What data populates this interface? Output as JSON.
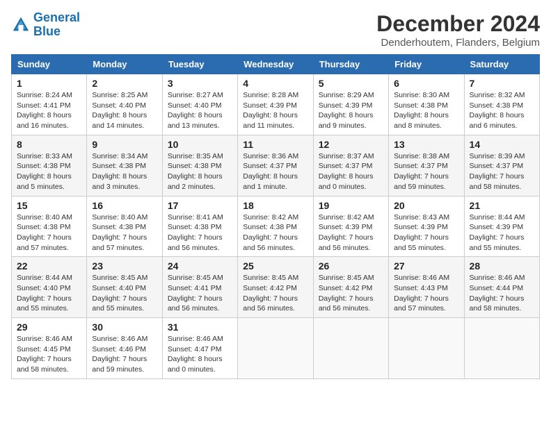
{
  "header": {
    "logo_line1": "General",
    "logo_line2": "Blue",
    "title": "December 2024",
    "subtitle": "Denderhoutem, Flanders, Belgium"
  },
  "calendar": {
    "days_of_week": [
      "Sunday",
      "Monday",
      "Tuesday",
      "Wednesday",
      "Thursday",
      "Friday",
      "Saturday"
    ],
    "weeks": [
      [
        null,
        {
          "day": "2",
          "sunrise": "Sunrise: 8:25 AM",
          "sunset": "Sunset: 4:40 PM",
          "daylight": "Daylight: 8 hours and 14 minutes."
        },
        {
          "day": "3",
          "sunrise": "Sunrise: 8:27 AM",
          "sunset": "Sunset: 4:40 PM",
          "daylight": "Daylight: 8 hours and 13 minutes."
        },
        {
          "day": "4",
          "sunrise": "Sunrise: 8:28 AM",
          "sunset": "Sunset: 4:39 PM",
          "daylight": "Daylight: 8 hours and 11 minutes."
        },
        {
          "day": "5",
          "sunrise": "Sunrise: 8:29 AM",
          "sunset": "Sunset: 4:39 PM",
          "daylight": "Daylight: 8 hours and 9 minutes."
        },
        {
          "day": "6",
          "sunrise": "Sunrise: 8:30 AM",
          "sunset": "Sunset: 4:38 PM",
          "daylight": "Daylight: 8 hours and 8 minutes."
        },
        {
          "day": "7",
          "sunrise": "Sunrise: 8:32 AM",
          "sunset": "Sunset: 4:38 PM",
          "daylight": "Daylight: 8 hours and 6 minutes."
        }
      ],
      [
        {
          "day": "1",
          "sunrise": "Sunrise: 8:24 AM",
          "sunset": "Sunset: 4:41 PM",
          "daylight": "Daylight: 8 hours and 16 minutes."
        },
        {
          "day": "9",
          "sunrise": "Sunrise: 8:34 AM",
          "sunset": "Sunset: 4:38 PM",
          "daylight": "Daylight: 8 hours and 3 minutes."
        },
        {
          "day": "10",
          "sunrise": "Sunrise: 8:35 AM",
          "sunset": "Sunset: 4:38 PM",
          "daylight": "Daylight: 8 hours and 2 minutes."
        },
        {
          "day": "11",
          "sunrise": "Sunrise: 8:36 AM",
          "sunset": "Sunset: 4:37 PM",
          "daylight": "Daylight: 8 hours and 1 minute."
        },
        {
          "day": "12",
          "sunrise": "Sunrise: 8:37 AM",
          "sunset": "Sunset: 4:37 PM",
          "daylight": "Daylight: 8 hours and 0 minutes."
        },
        {
          "day": "13",
          "sunrise": "Sunrise: 8:38 AM",
          "sunset": "Sunset: 4:37 PM",
          "daylight": "Daylight: 7 hours and 59 minutes."
        },
        {
          "day": "14",
          "sunrise": "Sunrise: 8:39 AM",
          "sunset": "Sunset: 4:37 PM",
          "daylight": "Daylight: 7 hours and 58 minutes."
        }
      ],
      [
        {
          "day": "8",
          "sunrise": "Sunrise: 8:33 AM",
          "sunset": "Sunset: 4:38 PM",
          "daylight": "Daylight: 8 hours and 5 minutes."
        },
        {
          "day": "16",
          "sunrise": "Sunrise: 8:40 AM",
          "sunset": "Sunset: 4:38 PM",
          "daylight": "Daylight: 7 hours and 57 minutes."
        },
        {
          "day": "17",
          "sunrise": "Sunrise: 8:41 AM",
          "sunset": "Sunset: 4:38 PM",
          "daylight": "Daylight: 7 hours and 56 minutes."
        },
        {
          "day": "18",
          "sunrise": "Sunrise: 8:42 AM",
          "sunset": "Sunset: 4:38 PM",
          "daylight": "Daylight: 7 hours and 56 minutes."
        },
        {
          "day": "19",
          "sunrise": "Sunrise: 8:42 AM",
          "sunset": "Sunset: 4:39 PM",
          "daylight": "Daylight: 7 hours and 56 minutes."
        },
        {
          "day": "20",
          "sunrise": "Sunrise: 8:43 AM",
          "sunset": "Sunset: 4:39 PM",
          "daylight": "Daylight: 7 hours and 55 minutes."
        },
        {
          "day": "21",
          "sunrise": "Sunrise: 8:44 AM",
          "sunset": "Sunset: 4:39 PM",
          "daylight": "Daylight: 7 hours and 55 minutes."
        }
      ],
      [
        {
          "day": "15",
          "sunrise": "Sunrise: 8:40 AM",
          "sunset": "Sunset: 4:38 PM",
          "daylight": "Daylight: 7 hours and 57 minutes."
        },
        {
          "day": "23",
          "sunrise": "Sunrise: 8:45 AM",
          "sunset": "Sunset: 4:40 PM",
          "daylight": "Daylight: 7 hours and 55 minutes."
        },
        {
          "day": "24",
          "sunrise": "Sunrise: 8:45 AM",
          "sunset": "Sunset: 4:41 PM",
          "daylight": "Daylight: 7 hours and 56 minutes."
        },
        {
          "day": "25",
          "sunrise": "Sunrise: 8:45 AM",
          "sunset": "Sunset: 4:42 PM",
          "daylight": "Daylight: 7 hours and 56 minutes."
        },
        {
          "day": "26",
          "sunrise": "Sunrise: 8:45 AM",
          "sunset": "Sunset: 4:42 PM",
          "daylight": "Daylight: 7 hours and 56 minutes."
        },
        {
          "day": "27",
          "sunrise": "Sunrise: 8:46 AM",
          "sunset": "Sunset: 4:43 PM",
          "daylight": "Daylight: 7 hours and 57 minutes."
        },
        {
          "day": "28",
          "sunrise": "Sunrise: 8:46 AM",
          "sunset": "Sunset: 4:44 PM",
          "daylight": "Daylight: 7 hours and 58 minutes."
        }
      ],
      [
        {
          "day": "22",
          "sunrise": "Sunrise: 8:44 AM",
          "sunset": "Sunset: 4:40 PM",
          "daylight": "Daylight: 7 hours and 55 minutes."
        },
        {
          "day": "30",
          "sunrise": "Sunrise: 8:46 AM",
          "sunset": "Sunset: 4:46 PM",
          "daylight": "Daylight: 7 hours and 59 minutes."
        },
        {
          "day": "31",
          "sunrise": "Sunrise: 8:46 AM",
          "sunset": "Sunset: 4:47 PM",
          "daylight": "Daylight: 8 hours and 0 minutes."
        },
        null,
        null,
        null,
        null
      ],
      [
        {
          "day": "29",
          "sunrise": "Sunrise: 8:46 AM",
          "sunset": "Sunset: 4:45 PM",
          "daylight": "Daylight: 7 hours and 58 minutes."
        },
        null,
        null,
        null,
        null,
        null,
        null
      ]
    ]
  }
}
